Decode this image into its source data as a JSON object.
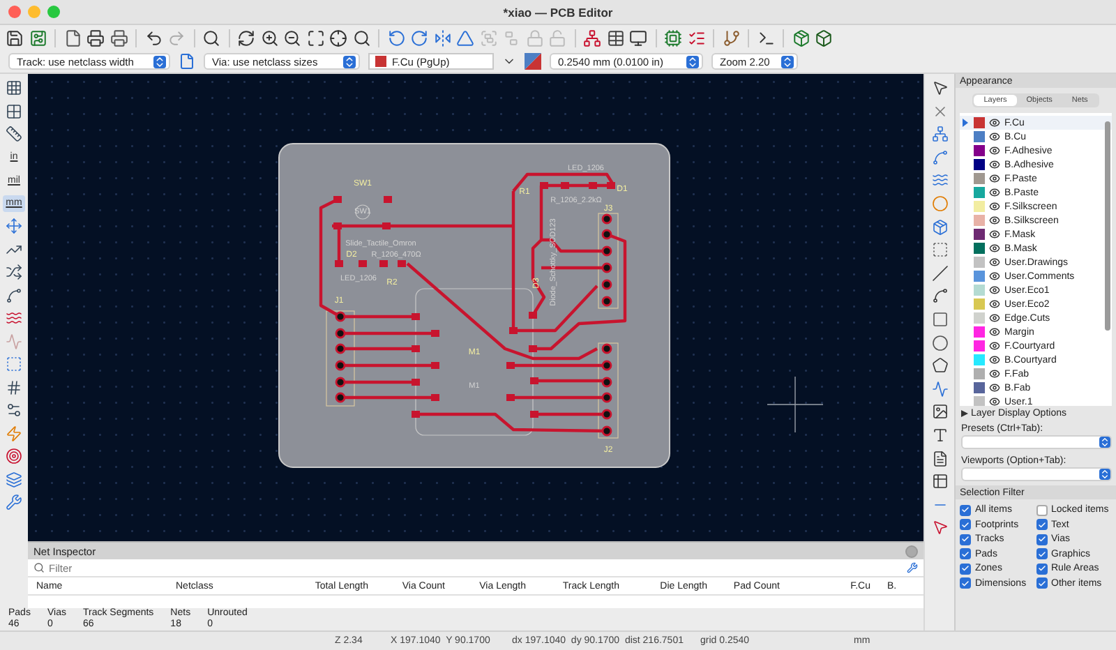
{
  "window": {
    "title": "*xiao — PCB Editor"
  },
  "options_bar": {
    "track_width": "Track: use netclass width",
    "via_size": "Via: use netclass sizes",
    "layer": {
      "label": "F.Cu (PgUp)",
      "color": "#c83434"
    },
    "grid": "0.2540 mm (0.0100 in)",
    "zoom": "Zoom 2.20"
  },
  "units": [
    {
      "label": "in",
      "selected": false
    },
    {
      "label": "mil",
      "selected": false
    },
    {
      "label": "mm",
      "selected": true
    }
  ],
  "board_labels": [
    {
      "text": "LED_1206",
      "kind": "value"
    },
    {
      "text": "SW1",
      "kind": "reference"
    },
    {
      "text": "R1",
      "kind": "reference"
    },
    {
      "text": "D1",
      "kind": "reference"
    },
    {
      "text": "R_1206_2.2kΩ",
      "kind": "value"
    },
    {
      "text": "J3",
      "kind": "reference"
    },
    {
      "text": "SW1",
      "kind": "value"
    },
    {
      "text": "Slide_Tactile_Omron",
      "kind": "value"
    },
    {
      "text": "D2",
      "kind": "reference"
    },
    {
      "text": "R_1206_470Ω",
      "kind": "value"
    },
    {
      "text": "D3",
      "kind": "reference"
    },
    {
      "text": "Diode_Schottky_SOD123",
      "kind": "value"
    },
    {
      "text": "LED_1206",
      "kind": "value"
    },
    {
      "text": "R2",
      "kind": "reference"
    },
    {
      "text": "J1",
      "kind": "reference"
    },
    {
      "text": "M1",
      "kind": "reference"
    },
    {
      "text": "M1",
      "kind": "value"
    },
    {
      "text": "J2",
      "kind": "reference"
    }
  ],
  "net_inspector": {
    "title": "Net Inspector",
    "filter": {
      "placeholder": "Filter"
    },
    "columns": [
      "Name",
      "Netclass",
      "Total Length",
      "Via Count",
      "Via Length",
      "Track Length",
      "Die Length",
      "Pad Count",
      "F.Cu",
      "B."
    ]
  },
  "stats": [
    {
      "label": "Pads",
      "value": "46"
    },
    {
      "label": "Vias",
      "value": "0"
    },
    {
      "label": "Track Segments",
      "value": "66"
    },
    {
      "label": "Nets",
      "value": "18"
    },
    {
      "label": "Unrouted",
      "value": "0"
    }
  ],
  "status_bar": {
    "zoom": "Z 2.34",
    "position": "X 197.1040  Y 90.1700",
    "delta": "dx 197.1040  dy 90.1700  dist 216.7501",
    "grid": "grid 0.2540",
    "units": "mm"
  },
  "appearance": {
    "title": "Appearance",
    "tabs": [
      {
        "label": "Layers",
        "selected": true
      },
      {
        "label": "Objects",
        "selected": false
      },
      {
        "label": "Nets",
        "selected": false
      }
    ],
    "layers": [
      {
        "name": "F.Cu",
        "color": "#c83434",
        "selected": true
      },
      {
        "name": "B.Cu",
        "color": "#4d7fc4",
        "selected": false
      },
      {
        "name": "F.Adhesive",
        "color": "#84008a",
        "selected": false
      },
      {
        "name": "B.Adhesive",
        "color": "#000084",
        "selected": false
      },
      {
        "name": "F.Paste",
        "color": "#a09890",
        "selected": false
      },
      {
        "name": "B.Paste",
        "color": "#17a89e",
        "selected": false
      },
      {
        "name": "F.Silkscreen",
        "color": "#f2eda1",
        "selected": false
      },
      {
        "name": "B.Silkscreen",
        "color": "#e8b2a7",
        "selected": false
      },
      {
        "name": "F.Mask",
        "color": "#6e2a72",
        "selected": false
      },
      {
        "name": "B.Mask",
        "color": "#036f5d",
        "selected": false
      },
      {
        "name": "User.Drawings",
        "color": "#c2c2c2",
        "selected": false
      },
      {
        "name": "User.Comments",
        "color": "#5994dc",
        "selected": false
      },
      {
        "name": "User.Eco1",
        "color": "#b4dbd2",
        "selected": false
      },
      {
        "name": "User.Eco2",
        "color": "#d8c852",
        "selected": false
      },
      {
        "name": "Edge.Cuts",
        "color": "#d0d2cd",
        "selected": false
      },
      {
        "name": "Margin",
        "color": "#ff26e2",
        "selected": false
      },
      {
        "name": "F.Courtyard",
        "color": "#ff26e2",
        "selected": false
      },
      {
        "name": "B.Courtyard",
        "color": "#26e9ff",
        "selected": false
      },
      {
        "name": "F.Fab",
        "color": "#afafaf",
        "selected": false
      },
      {
        "name": "B.Fab",
        "color": "#58659b",
        "selected": false
      },
      {
        "name": "User.1",
        "color": "#c2c2c2",
        "selected": false
      }
    ],
    "layer_display_options": {
      "label": "Layer Display Options",
      "expanded": false
    },
    "presets_label": "Presets (Ctrl+Tab):",
    "viewports_label": "Viewports (Option+Tab):"
  },
  "selection_filter": {
    "title": "Selection Filter",
    "items": [
      {
        "label": "All items",
        "checked": true
      },
      {
        "label": "Locked items",
        "checked": false
      },
      {
        "label": "Footprints",
        "checked": true
      },
      {
        "label": "Text",
        "checked": true
      },
      {
        "label": "Tracks",
        "checked": true
      },
      {
        "label": "Vias",
        "checked": true
      },
      {
        "label": "Pads",
        "checked": true
      },
      {
        "label": "Graphics",
        "checked": true
      },
      {
        "label": "Zones",
        "checked": true
      },
      {
        "label": "Rule Areas",
        "checked": true
      },
      {
        "label": "Dimensions",
        "checked": true
      },
      {
        "label": "Other items",
        "checked": true
      }
    ]
  }
}
